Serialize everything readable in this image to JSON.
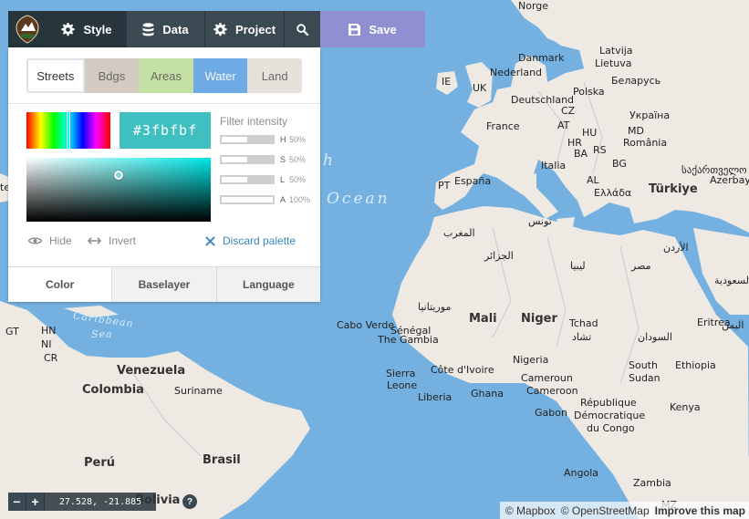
{
  "toolbar": {
    "style_label": "Style",
    "data_label": "Data",
    "project_label": "Project",
    "save_label": "Save"
  },
  "panel": {
    "layer_tabs": [
      "Streets",
      "Bdgs",
      "Areas",
      "Water",
      "Land"
    ],
    "selected_layer": "Water",
    "hex_value": "#3fbfbf",
    "filter_title": "Filter intensity",
    "filters": [
      {
        "channel": "H",
        "value": "50%",
        "level": 0.5
      },
      {
        "channel": "S",
        "value": "50%",
        "level": 0.5
      },
      {
        "channel": "L",
        "value": "50%",
        "level": 0.5
      },
      {
        "channel": "A",
        "value": "100%",
        "level": 1.0
      }
    ],
    "hide_label": "Hide",
    "invert_label": "Invert",
    "discard_label": "Discard palette",
    "bottom_tabs": [
      "Color",
      "Baselayer",
      "Language"
    ]
  },
  "zoom": {
    "minus": "−",
    "plus": "+"
  },
  "coordinates": "27.528, -21.885",
  "help_label": "?",
  "attribution": {
    "mapbox": "© Mapbox",
    "osm": "© OpenStreetMap",
    "improve": "Improve this map"
  },
  "map_labels": {
    "norge": "Norge",
    "danmark": "Danmark",
    "latvija": "Latvija",
    "lietuva": "Lietuva",
    "nederland": "Nederland",
    "ie": "IE",
    "uk": "UK",
    "belarus": "Беларусь",
    "deutschland": "Deutschland",
    "polska": "Polska",
    "france": "France",
    "cz": "CZ",
    "ukraina": "Україна",
    "at": "AT",
    "hu": "HU",
    "md": "MD",
    "hr": "HR",
    "romania": "România",
    "ba": "BA",
    "rs": "RS",
    "italia": "Italia",
    "bg": "BG",
    "pt": "PT",
    "espana": "España",
    "al": "AL",
    "ellada": "Ελλάδα",
    "turkiye": "Türkiye",
    "georgia": "საქართველო",
    "azerbaycan": "Azerbaycan",
    "tounes": "تونس",
    "maghrib": "المغرب",
    "jazair": "الجزائر",
    "libya": "ليبيا",
    "masr": "مصر",
    "urdun": "الأردن",
    "saudi": "السعودية",
    "mauritania": "موريتانيا",
    "mali": "Mali",
    "niger": "Niger",
    "tchad": "Tchad",
    "tshad": "تشاد",
    "sudan": "السودان",
    "eritrea": "Eritrea",
    "yemen": "اليمن",
    "ethiopia": "Ethiopia",
    "cabo_verde": "Cabo Verde",
    "senegal": "Sénégal",
    "gambia": "The Gambia",
    "sierra": "Sierra",
    "leone": "Leone",
    "liberia": "Liberia",
    "cote": "Côte d'Ivoire",
    "ghana": "Ghana",
    "nigeria": "Nigeria",
    "cameroun": "Cameroun",
    "cameroon": "Cameroon",
    "south": "South",
    "sudan_en": "Sudan",
    "gabon": "Gabon",
    "rdc1": "République",
    "rdc2": "Démocratique",
    "rdc3": "du Congo",
    "kenya": "Kenya",
    "angola": "Angola",
    "zambia": "Zambia",
    "mz": "MZ",
    "gt": "GT",
    "hn": "HN",
    "ni": "NI",
    "cr": "CR",
    "venezuela": "Venezuela",
    "colombia": "Colombia",
    "suriname": "Suriname",
    "peru": "Perú",
    "brasil": "Brasil",
    "bolivia": "Bolivia",
    "ocean": "Ocean",
    "caribbean": "Caribbean",
    "sea": "Sea",
    "atlantic_h": "h",
    "te": "te"
  },
  "colors": {
    "water": "#75b1e0",
    "land": "#eee9e3",
    "accent": "#3887be",
    "save": "#8f8fd2",
    "toolbar": "#3b4a52"
  }
}
